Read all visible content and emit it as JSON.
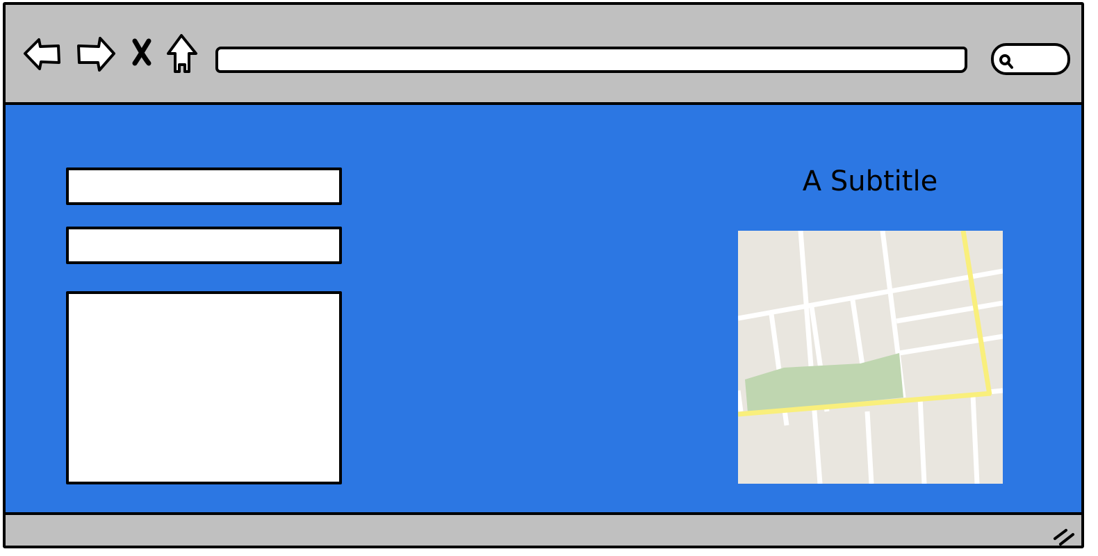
{
  "main": {
    "subtitle": "A Subtitle"
  },
  "icons": {
    "back": "back-arrow-icon",
    "forward": "forward-arrow-icon",
    "stop": "close-icon",
    "home": "home-icon",
    "search": "search-icon",
    "resize": "resize-grip-icon"
  },
  "colors": {
    "chrome": "#c0c0c0",
    "content_background": "#2c77e3",
    "map_land": "#e9e6df",
    "map_park": "#bfd6b0",
    "map_highway": "#f9ef7c"
  }
}
